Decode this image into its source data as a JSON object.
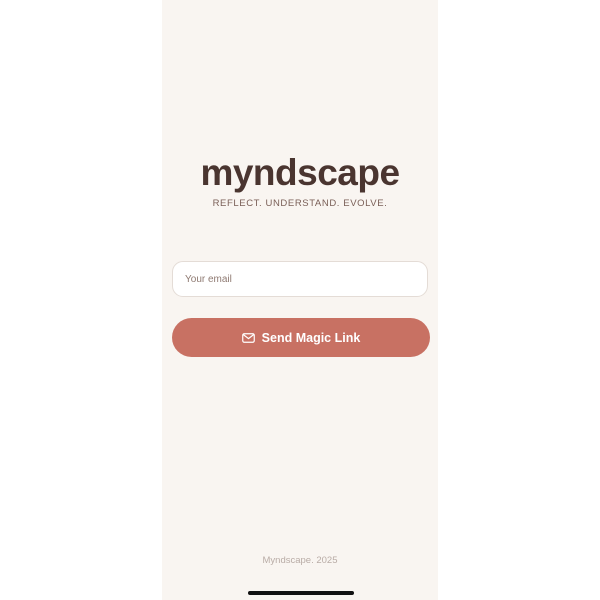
{
  "app": {
    "title": "myndscape",
    "tagline": "REFLECT. UNDERSTAND. EVOLVE."
  },
  "login": {
    "email_placeholder": "Your email",
    "email_value": "",
    "submit_label": "Send Magic Link",
    "submit_icon": "mail-icon"
  },
  "footer": {
    "text": "Myndscape. 2025"
  },
  "colors": {
    "background": "#f9f5f1",
    "brand_text": "#4a3530",
    "accent": "#c87163"
  }
}
